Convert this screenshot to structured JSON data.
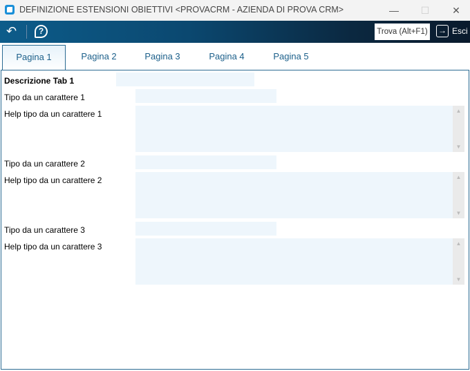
{
  "window": {
    "title": "DEFINIZIONE ESTENSIONI OBIETTIVI <PROVACRM - AZIENDA DI PROVA CRM>",
    "minimize": "—",
    "maximize": "☐",
    "close": "✕"
  },
  "toolbar": {
    "back_icon": "↶",
    "help_icon": "?",
    "find_label": "Trova (Alt+F1)",
    "exit_label": "Esci",
    "exit_icon": "→"
  },
  "tabs": [
    {
      "label": "Pagina 1"
    },
    {
      "label": "Pagina 2"
    },
    {
      "label": "Pagina 3"
    },
    {
      "label": "Pagina 4"
    },
    {
      "label": "Pagina 5"
    }
  ],
  "form": {
    "descrizione_label": "Descrizione Tab 1",
    "descrizione_value": "",
    "fields": [
      {
        "tipo_label": "Tipo da un carattere 1",
        "tipo_value": "",
        "help_label": "Help tipo da un carattere 1",
        "help_value": ""
      },
      {
        "tipo_label": "Tipo da un carattere 2",
        "tipo_value": "",
        "help_label": "Help tipo da un carattere 2",
        "help_value": ""
      },
      {
        "tipo_label": "Tipo da un carattere 3",
        "tipo_value": "",
        "help_label": "Help tipo da un carattere 3",
        "help_value": ""
      }
    ]
  }
}
